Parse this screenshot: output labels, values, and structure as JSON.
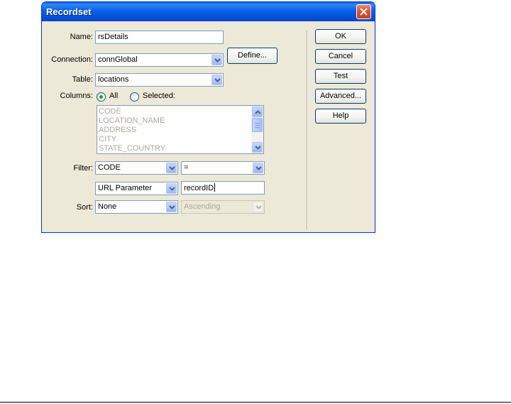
{
  "window": {
    "title": "Recordset",
    "close_icon": "close-icon"
  },
  "form": {
    "name_label": "Name:",
    "name_value": "rsDetails",
    "connection_label": "Connection:",
    "connection_value": "connGlobal",
    "define_button": "Define...",
    "table_label": "Table:",
    "table_value": "locations",
    "columns_label": "Columns:",
    "columns_all_label": "All",
    "columns_selected_label": "Selected:",
    "columns_mode": "All",
    "columns_list": [
      "CODE",
      "LOCATION_NAME",
      "ADDRESS",
      "CITY",
      "STATE_COUNTRY"
    ],
    "filter_label": "Filter:",
    "filter_column": "CODE",
    "filter_operator": "=",
    "filter_source": "URL Parameter",
    "filter_value": "recordID",
    "sort_label": "Sort:",
    "sort_column": "None",
    "sort_order": "Ascending"
  },
  "buttons": {
    "ok": "OK",
    "cancel": "Cancel",
    "test": "Test",
    "advanced": "Advanced...",
    "help": "Help"
  },
  "colors": {
    "titlebar": "#0a5fe8",
    "dialog_bg": "#ece9d8",
    "radio_checked": "#21a121",
    "close_button": "#d9532d"
  }
}
